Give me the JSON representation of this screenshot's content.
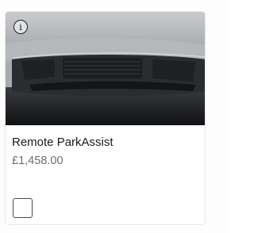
{
  "product": {
    "name": "Remote ParkAssist",
    "price": "£1,458.00",
    "image_alt": "Car front bumper close-up",
    "info_icon": "info-icon",
    "checkbox_checked": false
  },
  "colors": {
    "title": "#1a1a1a",
    "price": "#6b6d70",
    "border": "#e8e8e8"
  }
}
